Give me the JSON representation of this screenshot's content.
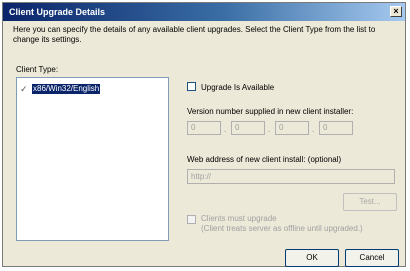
{
  "window": {
    "title": "Client Upgrade Details",
    "close_glyph": "×"
  },
  "description": "Here you can specify the details of any available client upgrades.  Select the Client Type from the list to change its settings.",
  "client_type": {
    "label": "Client Type:",
    "items": [
      {
        "label": "x86/Win32/English",
        "selected": true
      }
    ]
  },
  "upgrade_available": {
    "label": "Upgrade Is Available",
    "checked": false
  },
  "version": {
    "label": "Version number supplied in new client installer:",
    "parts": [
      "0",
      "0",
      "0",
      "0"
    ],
    "separator": "."
  },
  "web_address": {
    "label": "Web address of new client install: (optional)",
    "value": "http://"
  },
  "test_button": {
    "label": "Test..."
  },
  "must_upgrade": {
    "label": "Clients must upgrade",
    "sublabel": "(Client treats server as offline until upgraded.)",
    "checked": false,
    "enabled": false
  },
  "ok_button": {
    "label": "OK"
  },
  "cancel_button": {
    "label": "Cancel"
  },
  "colors": {
    "titlebar_start": "#0A246A",
    "selection": "#0A246A",
    "dialog_bg": "#ECE9D8"
  }
}
